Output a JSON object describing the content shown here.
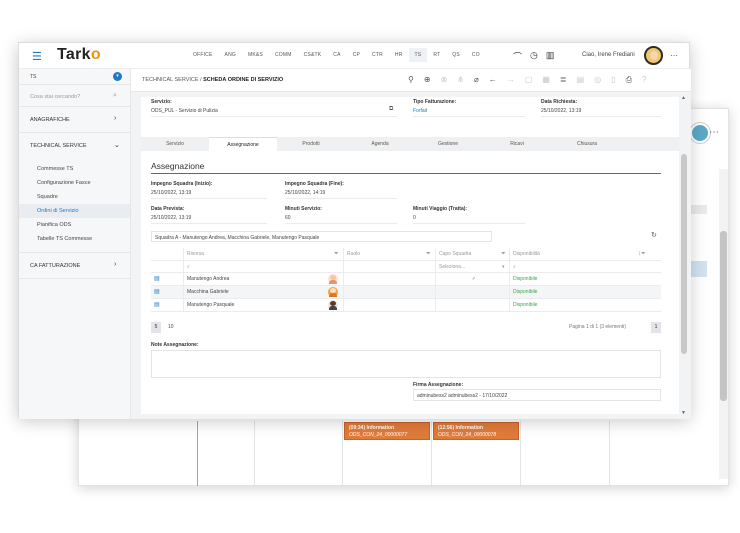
{
  "background_window": {
    "events": [
      {
        "time_title": "(09:34) Information",
        "code": "ODS_CON_24_00000077"
      },
      {
        "time_title": "(12:56) Information",
        "code": "ODS_CON_24_00000078"
      }
    ]
  },
  "app": {
    "logo": "Tark",
    "logo_accent": "o",
    "modules": [
      "OFFICE",
      "ANG",
      "MK&S",
      "COMM",
      "CS&TK",
      "CA",
      "CP",
      "CTR",
      "HR",
      "TS",
      "RT",
      "QS",
      "CO"
    ],
    "active_module": "TS",
    "greeting": "Ciao, Irene Frediani",
    "colors": {
      "accent": "#1e7ac4",
      "logo_accent": "#f39200",
      "success": "#3aa54a",
      "event": "#e07b3a"
    }
  },
  "sidebar": {
    "module": "TS",
    "search_placeholder": "Cosa stai cercando?",
    "sections": [
      {
        "label": "ANAGRAFICHE"
      },
      {
        "label": "TECHNICAL SERVICE"
      },
      {
        "label": "CA FATTURAZIONE"
      }
    ],
    "items": [
      "Commesse TS",
      "Configurazione Fasce",
      "Squadre",
      "Ordini di Servizio",
      "Pianifica ODS",
      "Tabelle TS Commesse"
    ],
    "active_item": "Ordini di Servizio"
  },
  "breadcrumb": {
    "path": "TECHNICAL SERVICE /",
    "current": "SCHEDA ORDINE DI SERVIZIO"
  },
  "form": {
    "servizio_label": "Servizio:",
    "servizio_value": "ODS_PUL - Servizio di Pulizia",
    "tipo_label": "Tipo Fatturazione:",
    "tipo_value": "Forfait",
    "data_richiesta_label": "Data Richiesta:",
    "data_richiesta_value": "25/10/2022, 13:19"
  },
  "tabs": [
    "Servizio",
    "Assegnazione",
    "Prodotti",
    "Agenda",
    "Gestione",
    "Ricavi",
    "Chiusura"
  ],
  "active_tab": "Assegnazione",
  "assegnazione": {
    "title": "Assegnazione",
    "inizio_label": "Impegno Squadra (Inizio):",
    "inizio_value": "25/10/2022, 13:19",
    "fine_label": "Impegno Squadra (Fine):",
    "fine_value": "25/10/2022, 14:19",
    "prevista_label": "Data Prevista:",
    "prevista_value": "25/10/2022, 13:19",
    "minuti_label": "Minuti Servizio:",
    "minuti_value": "60",
    "viaggio_label": "Minuti Viaggio (Tratta):",
    "viaggio_value": "0",
    "squadra": "Squadra A - Manutengo Andrea, Macchina Gabriele, Manutengo Pasquale",
    "grid": {
      "headers": [
        "Risorsa",
        "Ruolo",
        "Capo Squadra",
        "Disponibilità"
      ],
      "filter_placeholder": "Seleziona...",
      "rows": [
        {
          "risorsa": "Manutengo Andrea",
          "capo": "✓",
          "disponibilita": "Disponibile"
        },
        {
          "risorsa": "Macchina Gabriele",
          "capo": "",
          "disponibilita": "Disponibile"
        },
        {
          "risorsa": "Manutengo Pasquale",
          "capo": "",
          "disponibilita": "Disponibile"
        }
      ]
    },
    "pager": {
      "page": "5",
      "size": "10",
      "info": "Pagina 1 di 1 (3 elementi)",
      "current": "1"
    },
    "note_label": "Note Assegnazione:",
    "firma_label": "Firma Assegnazione:",
    "firma_value": "adminubess2 adminubess2 - 17/10/2022"
  }
}
